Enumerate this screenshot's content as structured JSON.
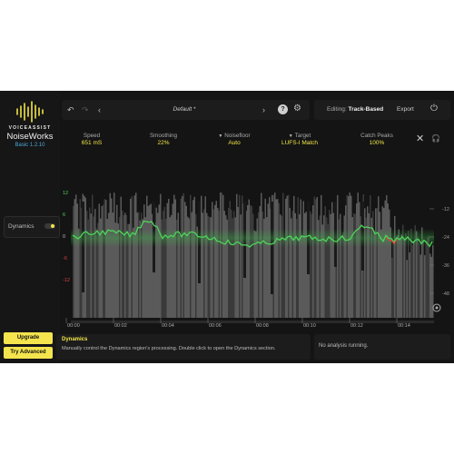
{
  "brand": {
    "small": "VOICEASSIST",
    "name": "NoiseWorks",
    "version": "Basic 1.2.10"
  },
  "toolbar": {
    "undo_icon": "undo-icon",
    "redo_icon": "redo-icon",
    "prev_icon": "chevron-left-icon",
    "next_icon": "chevron-right-icon",
    "preset": "Default *",
    "help": "?",
    "settings_icon": "gear-icon"
  },
  "editing": {
    "label": "Editing:",
    "value": "Track-Based"
  },
  "export_label": "Export",
  "power_icon": "power-icon",
  "params": [
    {
      "label": "Speed",
      "value": "651 mS"
    },
    {
      "label": "Smoothing",
      "value": "22%"
    },
    {
      "label": "Noisefloor",
      "value": "Auto"
    },
    {
      "label": "Target",
      "value": "LUFS-I Match"
    },
    {
      "label": "Catch Peaks",
      "value": "100%"
    }
  ],
  "sidebar": {
    "dynamics_label": "Dynamics",
    "dynamics_on": true
  },
  "buttons": {
    "upgrade": "Upgrade",
    "try_advanced": "Try Advanced"
  },
  "axis": {
    "left_ticks": [
      "12",
      "6",
      "0",
      "-6",
      "-12"
    ],
    "right_ticks": [
      "-12",
      "-24",
      "-36",
      "-48"
    ],
    "time_ticks": [
      "00:00",
      "00:02",
      "00:04",
      "00:06",
      "00:08",
      "00:10",
      "00:12",
      "00:14"
    ]
  },
  "info": {
    "title": "Dynamics",
    "text": "Manually control the Dynamics region's processing. Double click to open the Dynamics section.",
    "status": "No analysis running."
  },
  "colors": {
    "accent": "#f2e547",
    "curve": "#4ed45a",
    "version": "#4aa8d8"
  }
}
